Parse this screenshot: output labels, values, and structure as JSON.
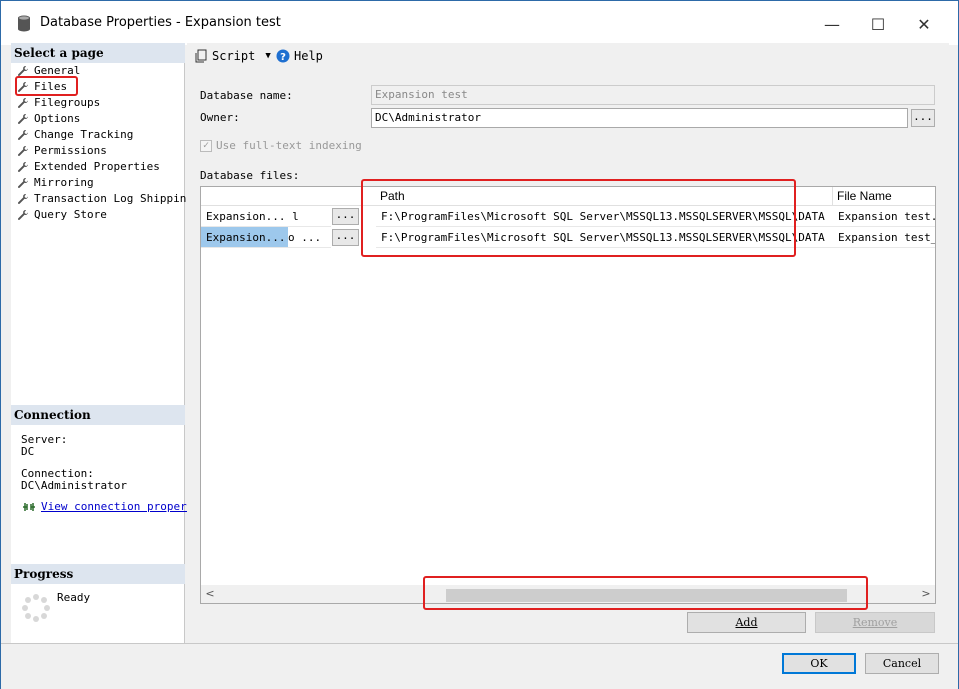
{
  "window": {
    "title": "Database Properties - Expansion test",
    "minimize_glyph": "—",
    "maximize_glyph": "☐",
    "close_glyph": "✕"
  },
  "left_panel": {
    "select_page_header": "Select a page",
    "pages": [
      {
        "label": "General",
        "icon": "wrench-icon"
      },
      {
        "label": "Files",
        "icon": "wrench-icon"
      },
      {
        "label": "Filegroups",
        "icon": "wrench-icon"
      },
      {
        "label": "Options",
        "icon": "wrench-icon"
      },
      {
        "label": "Change Tracking",
        "icon": "wrench-icon"
      },
      {
        "label": "Permissions",
        "icon": "wrench-icon"
      },
      {
        "label": "Extended Properties",
        "icon": "wrench-icon"
      },
      {
        "label": "Mirroring",
        "icon": "wrench-icon"
      },
      {
        "label": "Transaction Log Shipping",
        "icon": "wrench-icon"
      },
      {
        "label": "Query Store",
        "icon": "wrench-icon"
      }
    ],
    "connection_header": "Connection",
    "server_label": "Server:",
    "server_value": "DC",
    "connection_label": "Connection:",
    "connection_value": "DC\\Administrator",
    "view_connection_link": "View connection properti",
    "progress_header": "Progress",
    "progress_status": "Ready"
  },
  "toolbar": {
    "script_label": "Script",
    "help_label": "Help"
  },
  "form": {
    "db_name_label": "Database name:",
    "db_name_value": "Expansion test",
    "owner_label": "Owner:",
    "owner_value": "DC\\Administrator",
    "owner_browse": "...",
    "fulltext_label": "Use full-text indexing",
    "db_files_label": "Database files:"
  },
  "grid": {
    "columns": [
      "Path",
      "File Name"
    ],
    "rows": [
      {
        "logical": "Expansion... l",
        "browse": "...",
        "path": "F:\\ProgramFiles\\Microsoft SQL Server\\MSSQL13.MSSQLSERVER\\MSSQL\\DATA",
        "file_name": "Expansion test.mdf"
      },
      {
        "logical": "Expansion...",
        "logical_extra": "o ...",
        "browse": "...",
        "path": "F:\\ProgramFiles\\Microsoft SQL Server\\MSSQL13.MSSQLSERVER\\MSSQL\\DATA",
        "file_name": "Expansion test_log"
      }
    ],
    "scroll_left": "<",
    "scroll_right": ">"
  },
  "buttons": {
    "add": "Add",
    "remove": "Remove",
    "ok": "OK",
    "cancel": "Cancel"
  },
  "colors": {
    "highlight_red": "#e02020",
    "selected_row": "#9dc8ec",
    "section_header_bg": "#dde5ef"
  }
}
